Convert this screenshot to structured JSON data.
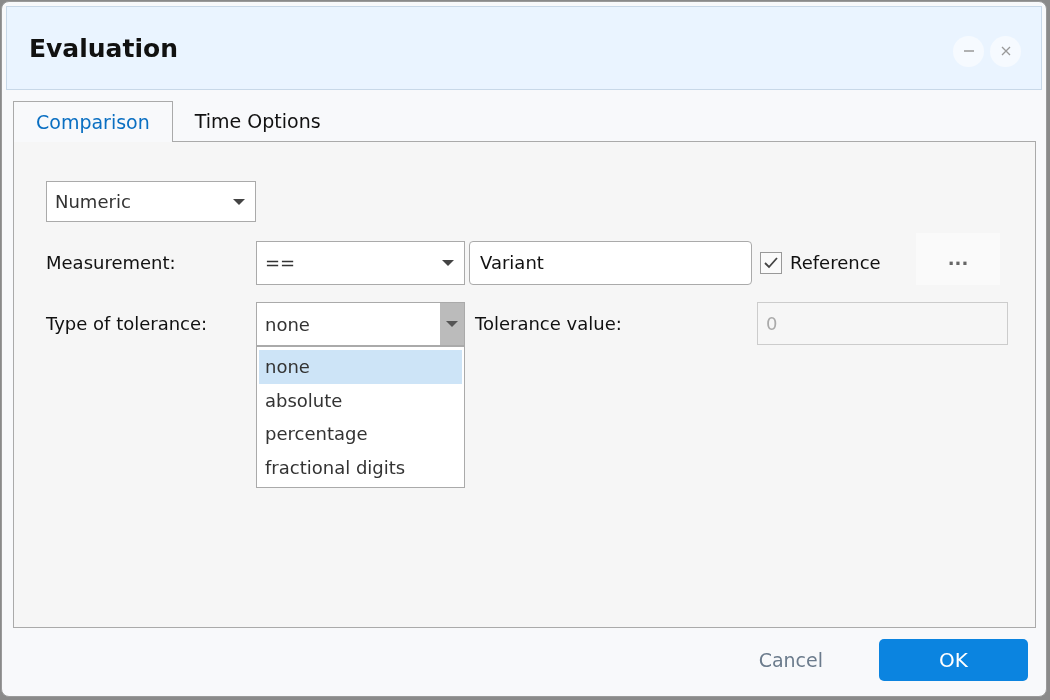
{
  "window": {
    "title": "Evaluation"
  },
  "tabs": [
    {
      "label": "Comparison",
      "selected": true
    },
    {
      "label": "Time Options",
      "selected": false
    }
  ],
  "type_select": {
    "value": "Numeric"
  },
  "measurement": {
    "label": "Measurement:",
    "operator": "==",
    "value": "Variant",
    "reference": {
      "label": "Reference",
      "checked": true
    },
    "more_button": "..."
  },
  "tolerance": {
    "label": "Type of tolerance:",
    "value": "none",
    "expanded": true,
    "options": [
      {
        "label": "none",
        "selected": true
      },
      {
        "label": "absolute",
        "selected": false
      },
      {
        "label": "percentage",
        "selected": false
      },
      {
        "label": "fractional digits",
        "selected": false
      }
    ],
    "value_label": "Tolerance value:",
    "value_field": {
      "value": "0",
      "disabled": true
    }
  },
  "buttons": {
    "cancel": "Cancel",
    "ok": "OK"
  }
}
